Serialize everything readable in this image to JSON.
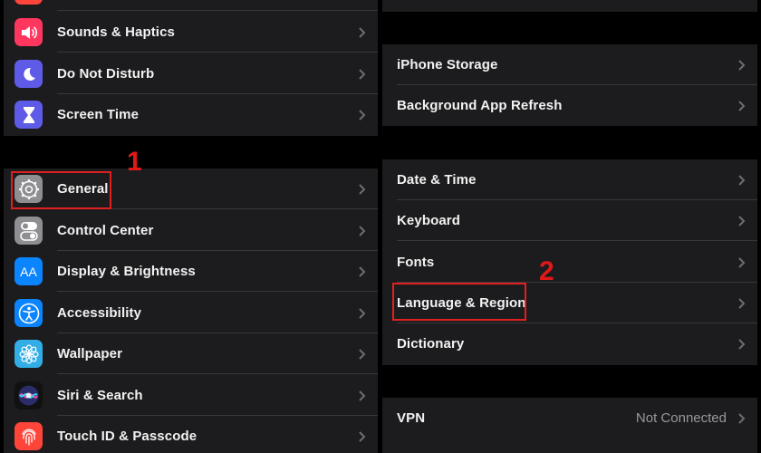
{
  "left_list": {
    "group1": [
      {
        "label": "Sounds & Haptics",
        "icon": "speaker-icon",
        "color": "#ff375f"
      },
      {
        "label": "Do Not Disturb",
        "icon": "moon-icon",
        "color": "#5e5ce6"
      },
      {
        "label": "Screen Time",
        "icon": "hourglass-icon",
        "color": "#5e5ce6"
      }
    ],
    "group2": [
      {
        "label": "General",
        "icon": "gear-icon",
        "color": "#8e8e93"
      },
      {
        "label": "Control Center",
        "icon": "toggles-icon",
        "color": "#8e8e93"
      },
      {
        "label": "Display & Brightness",
        "icon": "text-size-icon",
        "color": "#0a84ff"
      },
      {
        "label": "Accessibility",
        "icon": "accessibility-icon",
        "color": "#0a84ff"
      },
      {
        "label": "Wallpaper",
        "icon": "flower-icon",
        "color": "#32ade6"
      },
      {
        "label": "Siri & Search",
        "icon": "siri-icon",
        "color": "#1c1c1e"
      },
      {
        "label": "Touch ID & Passcode",
        "icon": "fingerprint-icon",
        "color": "#ff453a"
      }
    ],
    "display_icon_text": "AA"
  },
  "right_list": {
    "group1": [
      {
        "label": "iPhone Storage"
      },
      {
        "label": "Background App Refresh"
      }
    ],
    "group2": [
      {
        "label": "Date & Time"
      },
      {
        "label": "Keyboard"
      },
      {
        "label": "Fonts"
      },
      {
        "label": "Language & Region"
      },
      {
        "label": "Dictionary"
      }
    ],
    "group3": [
      {
        "label": "VPN",
        "value": "Not Connected"
      }
    ]
  },
  "annotations": {
    "step1": "1",
    "step2": "2",
    "highlight_color": "#e02020"
  }
}
